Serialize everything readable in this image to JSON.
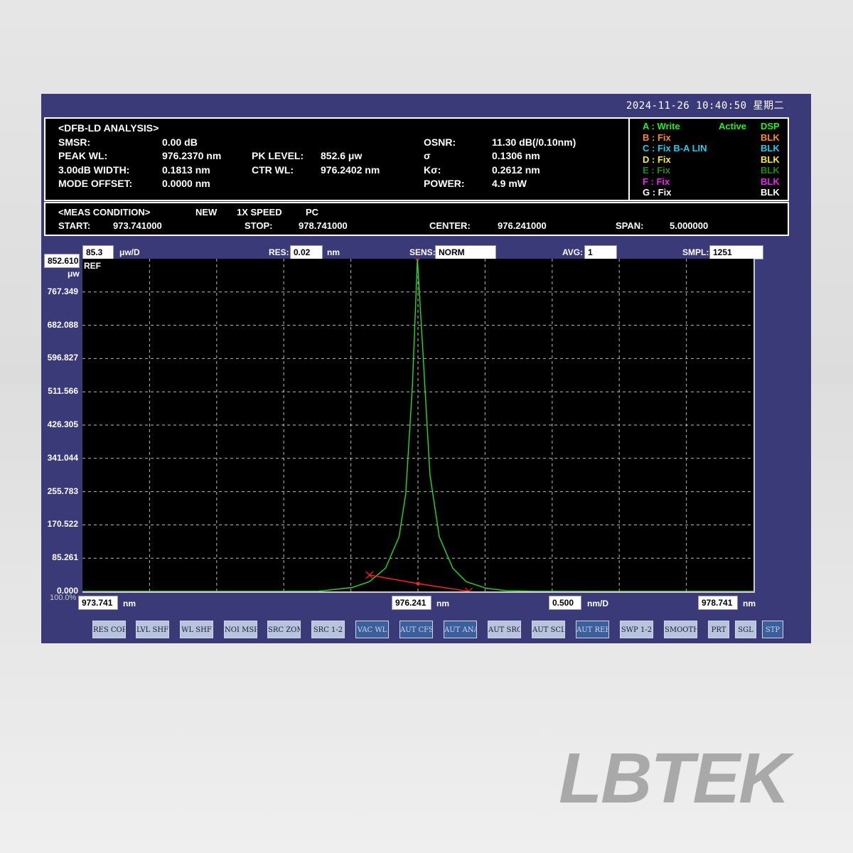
{
  "clock": "2024-11-26 10:40:50 星期二",
  "analysis": {
    "title": "<DFB-LD ANALYSIS>",
    "smsr_label": "SMSR:",
    "smsr": "0.00 dB",
    "peak_wl_label": "PEAK WL:",
    "peak_wl": "976.2370 nm",
    "width_label": "3.00dB WIDTH:",
    "width": "0.1813 nm",
    "mode_offset_label": "MODE OFFSET:",
    "mode_offset": "0.0000 nm",
    "pk_level_label": "PK LEVEL:",
    "pk_level": "852.6 μw",
    "ctr_wl_label": "CTR WL:",
    "ctr_wl": "976.2402 nm",
    "osnr_label": "OSNR:",
    "osnr": "11.30 dB(/0.10nm)",
    "sigma_label": "σ",
    "sigma": "0.1306 nm",
    "ksigma_label": "Kσ:",
    "ksigma": "0.2612 nm",
    "power_label": "POWER:",
    "power": "4.9 mW"
  },
  "traces": [
    {
      "label": "A : Write",
      "state": "Active",
      "mode": "DSP",
      "color": "#22ee22",
      "mode_color": "#22ee22"
    },
    {
      "label": "B : Fix",
      "state": "",
      "mode": "BLK",
      "color": "#ff8c1a",
      "mode_color": "#ff8c1a"
    },
    {
      "label": "C : Fix B-A LIN",
      "state": "",
      "mode": "BLK",
      "color": "#22ccee",
      "mode_color": "#22ccee"
    },
    {
      "label": "D : Fix",
      "state": "",
      "mode": "BLK",
      "color": "#ffee22",
      "mode_color": "#ffee22"
    },
    {
      "label": "E : Fix",
      "state": "",
      "mode": "BLK",
      "color": "#1e8a1e",
      "mode_color": "#1e8a1e"
    },
    {
      "label": "F : Fix",
      "state": "",
      "mode": "BLK",
      "color": "#ee22ee",
      "mode_color": "#ee22ee"
    },
    {
      "label": "G : Fix",
      "state": "",
      "mode": "BLK",
      "color": "#ffffff",
      "mode_color": "#ffffff"
    }
  ],
  "condition": {
    "title": "<MEAS CONDITION>",
    "new": "NEW",
    "speed": "1X SPEED",
    "pc": "PC",
    "start_label": "START:",
    "start": "973.741000",
    "stop_label": "STOP:",
    "stop": "978.741000",
    "center_label": "CENTER:",
    "center": "976.241000",
    "span_label": "SPAN:",
    "span": "5.000000"
  },
  "controls": {
    "ref_level": "852.610",
    "scale": "85.3",
    "scale_unit": "μw/D",
    "unit": "μw",
    "ref": "REF",
    "res_label": "RES:",
    "res": "0.02",
    "res_unit": "nm",
    "sens_label": "SENS:",
    "sens": "NORM",
    "avg_label": "AVG:",
    "avg": "1",
    "smpl_label": "SMPL:",
    "smpl": "1251",
    "x_start": "973.741",
    "x_center": "976.241",
    "x_div": "0.500",
    "x_stop": "978.741",
    "nm": "nm",
    "nmd": "nm/D",
    "pct": "100.0%"
  },
  "buttons": [
    {
      "label": "RES COR",
      "style": "light"
    },
    {
      "label": "LVL SHF",
      "style": "light"
    },
    {
      "label": "WL SHF",
      "style": "light"
    },
    {
      "label": "NOI MSR",
      "style": "light"
    },
    {
      "label": "SRC ZOM",
      "style": "light"
    },
    {
      "label": "SRC 1-2",
      "style": "light"
    },
    {
      "label": "VAC WL",
      "style": "dark"
    },
    {
      "label": "AUT CFS",
      "style": "dark"
    },
    {
      "label": "AUT ANA",
      "style": "dark"
    },
    {
      "label": "AUT SRC",
      "style": "light"
    },
    {
      "label": "AUT SCL",
      "style": "light"
    },
    {
      "label": "AUT REF",
      "style": "dark"
    },
    {
      "label": "SWP 1-2",
      "style": "light"
    },
    {
      "label": "SMOOTH",
      "style": "light"
    },
    {
      "label": "PRT",
      "style": "light"
    },
    {
      "label": "SGL",
      "style": "light"
    },
    {
      "label": "STP",
      "style": "dark"
    }
  ],
  "logo": "LBTEK",
  "chart_data": {
    "type": "line",
    "xlabel": "nm",
    "ylabel": "μw",
    "xlim": [
      973.741,
      978.741
    ],
    "ylim": [
      0.0,
      852.61
    ],
    "y_ticks": [
      "852.610",
      "767.349",
      "682.088",
      "596.827",
      "511.566",
      "426.305",
      "341.044",
      "255.783",
      "170.522",
      "85.261",
      "0.000"
    ],
    "grid": true,
    "series": [
      {
        "color": "#22dd22",
        "x": [
          973.741,
          975.0,
          975.5,
          975.75,
          975.88,
          976.0,
          976.1,
          976.15,
          976.2,
          976.237,
          976.28,
          976.33,
          976.4,
          976.5,
          976.6,
          976.75,
          976.9,
          977.1,
          978.741
        ],
        "y": [
          0,
          0,
          0.5,
          10,
          25,
          60,
          140,
          250,
          530,
          852.6,
          600,
          300,
          140,
          60,
          25,
          8,
          2,
          0.3,
          0
        ]
      },
      {
        "color": "#ff2222",
        "x": [
          975.88,
          976.241,
          976.62
        ],
        "y": [
          42,
          20,
          0
        ]
      }
    ],
    "markers": [
      {
        "x": 975.88,
        "y": 42,
        "shape": "x"
      },
      {
        "x": 976.241,
        "y": 20,
        "shape": "dot"
      },
      {
        "x": 976.62,
        "y": 0,
        "shape": "x"
      },
      {
        "x": 976.237,
        "y": 852.6,
        "shape": "dot"
      }
    ]
  }
}
